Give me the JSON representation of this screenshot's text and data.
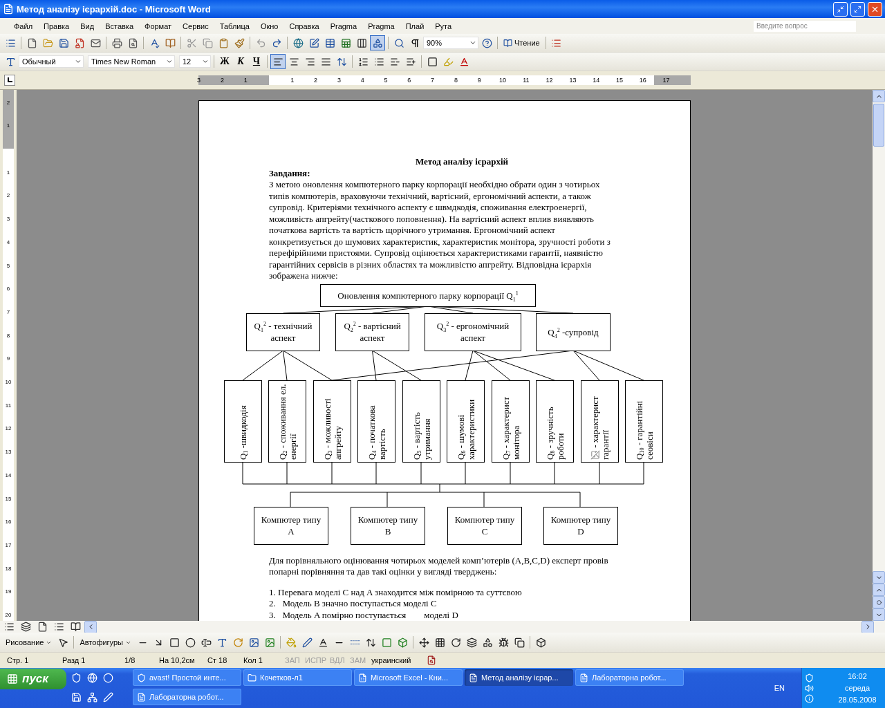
{
  "window": {
    "title": "Метод аналізу ієрархій.doc - Microsoft Word"
  },
  "menu": {
    "items": [
      "Файл",
      "Правка",
      "Вид",
      "Вставка",
      "Формат",
      "Сервис",
      "Таблица",
      "Окно",
      "Справка",
      "Pragma",
      "Pragma",
      "Плай",
      "Рута"
    ],
    "help_placeholder": "Введите вопрос"
  },
  "standard_toolbar": {
    "zoom": "90%",
    "read_button": "Чтение"
  },
  "formatting_toolbar": {
    "style": "Обычный",
    "font": "Times New Roman",
    "size": "12",
    "bold": "Ж",
    "italic": "К",
    "underline": "Ч",
    "alignments": [
      {
        "selected": true
      },
      {
        "selected": false
      },
      {
        "selected": false
      },
      {
        "selected": false
      }
    ]
  },
  "horizontal_ruler": [
    "3",
    "2",
    "1",
    "1",
    "2",
    "3",
    "4",
    "5",
    "6",
    "7",
    "8",
    "9",
    "10",
    "11",
    "12",
    "13",
    "14",
    "15",
    "16",
    "17"
  ],
  "vertical_ruler": [
    "2",
    "1",
    "1",
    "2",
    "3",
    "4",
    "5",
    "6",
    "7",
    "8",
    "9",
    "10",
    "11",
    "12",
    "13",
    "14",
    "15",
    "16",
    "17",
    "18",
    "19",
    "20"
  ],
  "document": {
    "title": "Метод аналізу ієрархій",
    "task_label": "Завдання:",
    "intro_lines": [
      "З метою оновлення компютерного парку корпорації необхідно обрати один з чотирьох",
      "типів компютерів,  враховуючи технічний, вартісний, ергономічний аспекти, а також",
      "супровід. Критеріями технічного аспекту є швмдкодія, споживання електроенергії,",
      "можливість апгрейту(часткового поповнення).  На вартісний аспект вплив виявляють",
      "початкова вартість та вартість щорічного утримання. Ергономічний аспект",
      "конкретизується до шумових характеристик, характеристик монітора, зручності роботи з",
      "перефірійними пристоями. Супровід оцінюється характеристиками гарантії, наявністю",
      "гарантійних сервісів в різних областях та можливістю апгрейту. Відповідна ієрархія",
      "зображена нижче:"
    ],
    "diagram": {
      "root": "Оновлення компютерного парку корпорації  Q$_{1}$$^{1}$",
      "aspects": [
        "Q$_{1}$$^{2}$ - технічний аспект",
        "Q$_{2}$$^{2}$ - вартісний аспект",
        "Q$_{3}$$^{2}$ - ергономічний аспект",
        "Q$_{4}$$^{2}$ -супровід"
      ],
      "criteria": [
        {
          "kind": "formula",
          "symbol": "Q$_{1}$",
          "label": "-швидкодія"
        },
        {
          "kind": "formula",
          "symbol": "Q$_{2}$",
          "label": "- споживання ел. енергії"
        },
        {
          "kind": "formula",
          "symbol": "Q$_{3}$",
          "label": "- можливості апгрейту"
        },
        {
          "kind": "formula",
          "symbol": "Q$_{4}$",
          "label": "- початкова вартість"
        },
        {
          "kind": "formula",
          "symbol": "Q$_{5}$",
          "label": "- вартість утримання"
        },
        {
          "kind": "formula",
          "symbol": "Q$_{6}$",
          "label": "-  шумові характеристики"
        },
        {
          "kind": "formula",
          "symbol": "Q$_{7}$",
          "label": "- характерист монітора"
        },
        {
          "kind": "formula",
          "symbol": "Q$_{8}$",
          "label": "- зручність роботи"
        },
        {
          "kind": "broken",
          "label": "- характерист гарантії"
        },
        {
          "kind": "formula",
          "symbol": "Q$_{10}$",
          "label": "- гарантійні сеовіси"
        }
      ],
      "computers": [
        "Компютер типу A",
        "Компютер типу B",
        "Компютер типу C",
        "Компютер типу D"
      ]
    },
    "after_lines": [
      "Для порівняльного оцінювання чотирьох моделей комп’ютерів (A,B,C,D) експерт провів",
      "попарні порівняння та дав такі оцінки у вигляді тверджень:"
    ],
    "list": [
      "1. Перевага моделі C над A знаходится між помірною та суттєвою",
      "2.   Модель B значно поступається моделі C",
      "3.   Модель A помірно поступається        моделі D"
    ]
  },
  "drawing_toolbar": {
    "draw_menu": "Рисование",
    "autoshapes_menu": "Автофигуры"
  },
  "status_bar": {
    "page": "Стр. 1",
    "section": "Разд 1",
    "pages": "1/8",
    "position": "На 10,2см",
    "line": "Ст 18",
    "column": "Кол 1",
    "modes": [
      {
        "label": "ЗАП",
        "disabled": true
      },
      {
        "label": "ИСПР",
        "disabled": true
      },
      {
        "label": "ВДЛ",
        "disabled": true
      },
      {
        "label": "ЗАМ",
        "disabled": true
      }
    ],
    "language": "украинский"
  },
  "taskbar": {
    "start": "пуск",
    "task_rows": [
      [
        {
          "label": "avast! Простой инте...",
          "kind": "avast",
          "selected": false
        },
        {
          "label": "Кочетков-л1",
          "kind": "folder",
          "selected": false
        },
        {
          "label": "Microsoft Excel - Кни...",
          "kind": "excel",
          "selected": false
        },
        {
          "label": "Метод аналізу ієрар...",
          "kind": "word",
          "selected": true
        },
        {
          "label": "Лабораторна робот...",
          "kind": "word",
          "selected": false
        }
      ],
      [
        {
          "label": "Лабораторна робот...",
          "kind": "word",
          "selected": false
        }
      ]
    ]
  },
  "tray": {
    "language": "EN",
    "time": "16:02",
    "day": "середа",
    "date": "28.05.2008"
  }
}
